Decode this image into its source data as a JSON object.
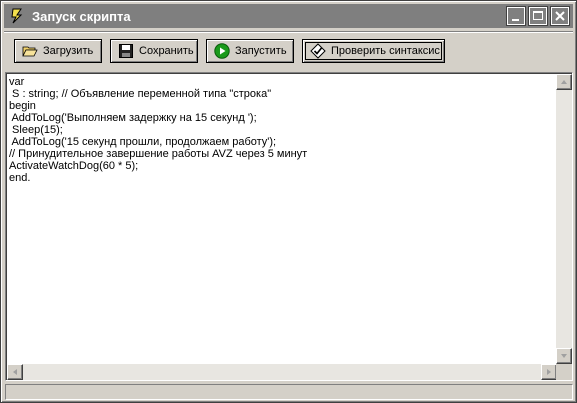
{
  "window": {
    "title": "Запуск скрипта"
  },
  "toolbar": {
    "load_label": "Загрузить",
    "save_label": "Сохранить",
    "run_label": "Запустить",
    "check_syntax_label": "Проверить синтаксис"
  },
  "editor": {
    "lines": [
      "var",
      " S : string; // Объявление переменной типа \"строка\"",
      "begin",
      " AddToLog('Выполняем задержку на 15 секунд ');",
      " Sleep(15);",
      " AddToLog('15 секунд прошли, продолжаем работу');",
      "// Принудительное завершение работы AVZ через 5 минут",
      "ActivateWatchDog(60 * 5);",
      "end."
    ]
  },
  "status": {
    "text": ""
  }
}
